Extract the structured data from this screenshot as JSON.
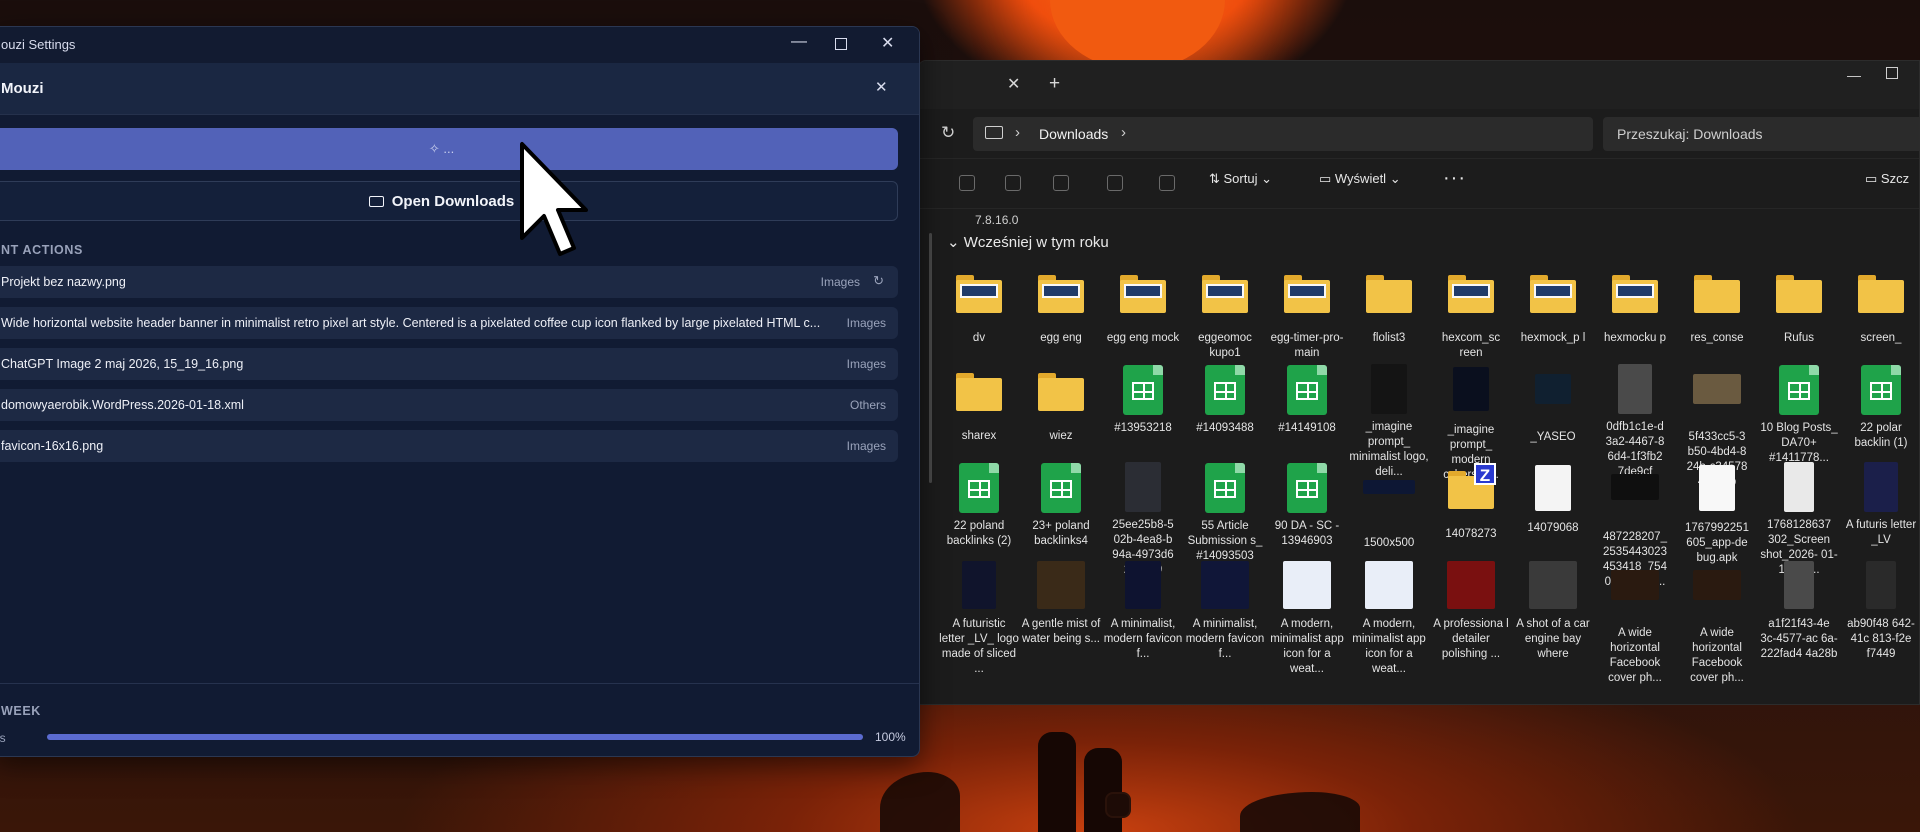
{
  "mouzi": {
    "window_title": "ouzi Settings",
    "app_title": "Mouzi",
    "primary_button_label": "...",
    "open_downloads_label": "Open Downloads",
    "recent_section_label": "NT ACTIONS",
    "recent_items": [
      {
        "name": "Projekt bez nazwy.png",
        "type": "Images"
      },
      {
        "name": "Wide horizontal website header banner in minimalist retro pixel art style. Centered is a pixelated coffee cup icon flanked by large pixelated HTML c...",
        "type": "Images"
      },
      {
        "name": "ChatGPT Image 2 maj 2026, 15_19_16.png",
        "type": "Images"
      },
      {
        "name": "domowyaerobik.WordPress.2026-01-18.xml",
        "type": "Others"
      },
      {
        "name": "favicon-16x16.png",
        "type": "Images"
      }
    ],
    "week_section_label": "WEEK",
    "week_side_label": "es",
    "week_progress": 100,
    "week_progress_label": "100%",
    "accent_color": "#5262b8"
  },
  "explorer": {
    "breadcrumb": "Downloads",
    "search_placeholder": "Przeszukaj: Downloads",
    "sort_label": "Sortuj",
    "view_label": "Wyświetl",
    "details_label": "Szcz",
    "version_text": "7.8.16.0",
    "group_label": "Wcześniej w tym roku",
    "files": [
      [
        "dv",
        "egg eng",
        "egg eng mock",
        "eggeomoc kupo1",
        "egg-timer-pro-main",
        "flolist3",
        "hexcom_sc reen",
        "hexmock_p l",
        "hexmocku p",
        "res_conse",
        "Rufus",
        "screen_"
      ],
      [
        "sharex",
        "wiez",
        "#13953218",
        "#14093488",
        "#14149108",
        "_imagine prompt_ minimalist logo, deli...",
        "_imagine prompt_ modern cybersec...",
        "_YASEO",
        "0dfb1c1e-d 3a2-4467-8 6d4-1f3fb2 7de9cf",
        "5f433cc5-3 b50-4bd4-8 24b-c34578 47640b",
        "10 Blog Posts_ DA70+ #1411778...",
        "22 polar backlin (1)"
      ],
      [
        "22 poland backlinks (2)",
        "23+ poland backlinks4",
        "25ee25b8-5 02b-4ea8-b 94a-4973d6 250649",
        "55 Article Submission s_ #14093503",
        "90 DA - SC - 13946903",
        "1500x500",
        "14078273",
        "14079068",
        "487228207_ 2535443023 453418_754 01727100...",
        "1767992251 605_app-de bug.apk",
        "1768128637 302_Screen shot_2026- 01-11-11-...",
        "A futuris letter _LV"
      ],
      [
        "A futuristic letter _LV_ logo made of sliced ...",
        "A gentle mist of water being s...",
        "A minimalist, modern favicon f...",
        "A minimalist, modern favicon f...",
        "A modern, minimalist app icon for a weat...",
        "A modern, minimalist app icon for a weat...",
        "A professiona l detailer polishing ...",
        "A shot of a car engine bay where",
        "A wide horizontal Facebook cover ph...",
        "A wide horizontal Facebook cover ph...",
        "a1f21f43-4e 3c-4577-ac 6a-222fad4 4a28b",
        "ab90f48 642-41c 813-f2e f7449"
      ]
    ]
  }
}
